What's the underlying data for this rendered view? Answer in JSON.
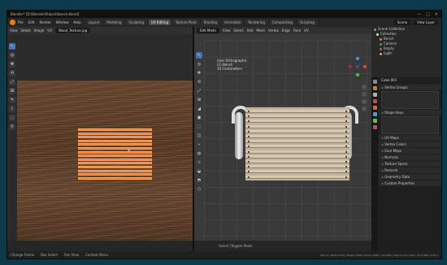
{
  "window": {
    "title": "Blender* [D:\\Blender\\Project\\bench.blend]",
    "buttons": [
      "—",
      "□",
      "✕"
    ]
  },
  "topbar": {
    "menus": [
      "File",
      "Edit",
      "Render",
      "Window",
      "Help"
    ],
    "tabs": [
      "Layout",
      "Modeling",
      "Sculpting",
      "UV Editing",
      "Texture Paint",
      "Shading",
      "Animation",
      "Rendering",
      "Compositing",
      "Scripting"
    ],
    "active_tab": "UV Editing",
    "scene": "Scene",
    "view_layer": "View Layer"
  },
  "image_editor": {
    "header": [
      "View",
      "Select",
      "Image",
      "UV"
    ],
    "image_name": "Wood_Texture.jpg",
    "tools": [
      "↖",
      "◎",
      "✥",
      "⟲",
      "⤢",
      "⊞",
      "✎",
      "⌇",
      "◌",
      "⚲"
    ]
  },
  "viewport": {
    "mode": "Edit Mode",
    "header": [
      "View",
      "Select",
      "Add",
      "Mesh",
      "Vertex",
      "Edge",
      "Face",
      "UV"
    ],
    "info": [
      "User Orthographic",
      "(1) Bench",
      "10 Centimeters"
    ],
    "tools": [
      "↖",
      "◎",
      "✥",
      "⟲",
      "⤢",
      "⊞",
      "◢",
      "▣",
      "⬚",
      "◫",
      "⌁",
      "◍",
      "⟐",
      "◒",
      "◓",
      "⬡"
    ],
    "footer": "Select (Toggle) Mode",
    "slat_count": 14
  },
  "outliner": {
    "rows": [
      {
        "label": "Scene Collection",
        "color": "#888888"
      },
      {
        "label": "Collection",
        "color": "#cccccc"
      },
      {
        "label": "Bench",
        "color": "#e87d0d"
      },
      {
        "label": "Camera",
        "color": "#4a8f4a"
      },
      {
        "label": "Empty",
        "color": "#c05050"
      },
      {
        "label": "Light",
        "color": "#d0a030"
      }
    ]
  },
  "properties": {
    "object": "Cube.001",
    "sections_top": [
      "Vertex Groups",
      "Shape Keys"
    ],
    "sections": [
      "UV Maps",
      "Vertex Colors",
      "Face Maps",
      "Normals",
      "Texture Space",
      "Remesh",
      "Geometry Data",
      "Custom Properties"
    ]
  },
  "status": {
    "left": [
      "Change Frame",
      "Box Select",
      "Pan View",
      "Context Menu"
    ],
    "right": "Bench | Verts 0/376 | Edges 0/664 | Faces 0/304 | Tris 608 | Objects 1/4 | Mem: 43.2 MiB | 2.90.1"
  }
}
